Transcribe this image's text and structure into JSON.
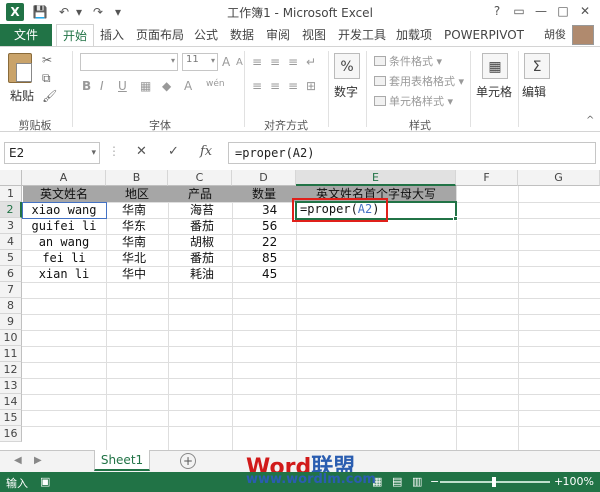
{
  "window": {
    "title": "工作簿1 - Microsoft Excel",
    "app_logo": "X",
    "controls": {
      "help": "?",
      "restore": "▭",
      "minimize": "—",
      "maximize": "□",
      "close": "✕"
    }
  },
  "quick_access": {
    "save": "💾",
    "undo": "↶",
    "redo": "↷",
    "more": "▾"
  },
  "ribbon_tabs": {
    "file": "文件",
    "items": [
      "开始",
      "插入",
      "页面布局",
      "公式",
      "数据",
      "审阅",
      "视图",
      "开发工具",
      "加载项",
      "POWERPIVOT"
    ],
    "active_index": 0
  },
  "user": {
    "name": "胡俊"
  },
  "ribbon": {
    "clipboard": {
      "paste": "粘贴",
      "label": "剪贴板"
    },
    "font": {
      "font_name": "",
      "font_size": "11",
      "label": "字体",
      "bold": "B",
      "italic": "I",
      "underline": "U",
      "grow": "A",
      "shrink": "A",
      "wen": "wén"
    },
    "alignment": {
      "label": "对齐方式"
    },
    "number": {
      "label": "数字",
      "icon": "%"
    },
    "styles": {
      "label": "样式",
      "conditional": "条件格式 ▾",
      "table_format": "套用表格格式 ▾",
      "cell_styles": "单元格样式 ▾"
    },
    "cells": {
      "label": "单元格"
    },
    "editing": {
      "label": "编辑"
    }
  },
  "formula_bar": {
    "name_box": "E2",
    "cancel": "✕",
    "enter": "✓",
    "fx": "fx",
    "content": "=proper(A2)"
  },
  "grid": {
    "columns": [
      "A",
      "B",
      "C",
      "D",
      "E",
      "F",
      "G"
    ],
    "rows": [
      "1",
      "2",
      "3",
      "4",
      "5",
      "6",
      "7",
      "8",
      "9",
      "10",
      "11",
      "12",
      "13",
      "14",
      "15",
      "16"
    ],
    "headers": [
      "英文姓名",
      "地区",
      "产品",
      "数量",
      "英文姓名首个字母大写"
    ],
    "data": [
      [
        "xiao wang",
        "华南",
        "海苔",
        "34"
      ],
      [
        "guifei li",
        "华东",
        "番茄",
        "56"
      ],
      [
        "an wang",
        "华南",
        "胡椒",
        "22"
      ],
      [
        "fei li",
        "华北",
        "番茄",
        "85"
      ],
      [
        "xian li",
        "华中",
        "耗油",
        "45"
      ]
    ],
    "editing_cell": {
      "prefix": "=proper(",
      "ref": "A2",
      "suffix": ")"
    }
  },
  "sheets": {
    "tabs": [
      "Sheet1"
    ],
    "add": "+",
    "nav_prev": "◀",
    "nav_next": "▶"
  },
  "watermark": {
    "word": "Word",
    "cn": "联盟",
    "url": "www.wordlm.com"
  },
  "status": {
    "mode": "输入",
    "zoom": "100%",
    "zoom_minus": "−",
    "zoom_plus": "+"
  },
  "colors": {
    "accent": "#217346",
    "highlight": "#e0201a",
    "ref": "#4472c4",
    "header_fill": "#a6a6a6"
  }
}
